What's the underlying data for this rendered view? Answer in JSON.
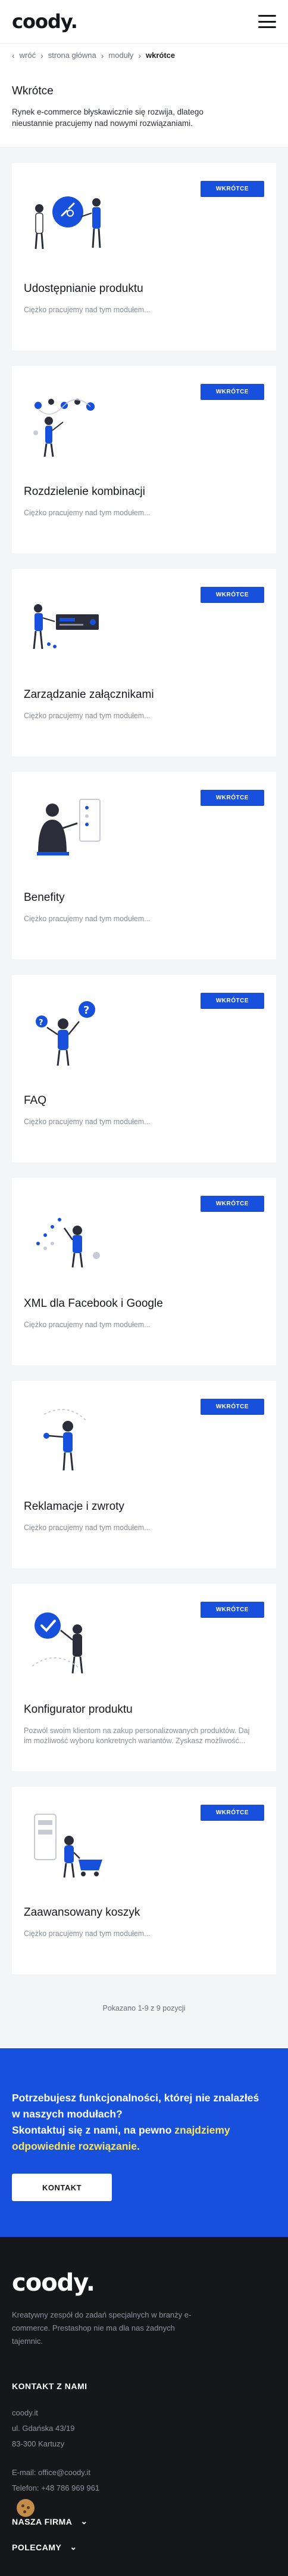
{
  "header": {
    "logo": "coody.",
    "menu_icon": "hamburger-icon"
  },
  "breadcrumb": {
    "back_label": "wróć",
    "items": [
      "strona główna",
      "moduły",
      "wkrótce"
    ]
  },
  "intro": {
    "title": "Wkrótce",
    "text": "Rynek e-commerce błyskawicznie się rozwija, dlatego nieustannie pracujemy nad nowymi rozwiązaniami."
  },
  "badge_label": "WKRÓTCE",
  "cards": [
    {
      "title": "Udostępnianie produktu",
      "desc": "Ciężko pracujemy nad tym modułem...",
      "illustration": "share-illustration"
    },
    {
      "title": "Rozdzielenie kombinacji",
      "desc": "Ciężko pracujemy nad tym modułem...",
      "illustration": "combinations-illustration"
    },
    {
      "title": "Zarządzanie załącznikami",
      "desc": "Ciężko pracujemy nad tym modułem...",
      "illustration": "attachments-illustration"
    },
    {
      "title": "Benefity",
      "desc": "Ciężko pracujemy nad tym modułem...",
      "illustration": "benefits-illustration"
    },
    {
      "title": "FAQ",
      "desc": "Ciężko pracujemy nad tym modułem...",
      "illustration": "faq-illustration"
    },
    {
      "title": "XML dla Facebook i Google",
      "desc": "Ciężko pracujemy nad tym modułem...",
      "illustration": "xml-illustration"
    },
    {
      "title": "Reklamacje i zwroty",
      "desc": "Ciężko pracujemy nad tym modułem...",
      "illustration": "returns-illustration"
    },
    {
      "title": "Konfigurator produktu",
      "desc": "Pozwól swoim klientom na zakup personalizowanych produktów. Daj im możliwość wyboru konkretnych wariantów. Zyskasz możliwość...",
      "illustration": "configurator-illustration"
    },
    {
      "title": "Zaawansowany koszyk",
      "desc": "Ciężko pracujemy nad tym modułem...",
      "illustration": "cart-illustration"
    }
  ],
  "pager": "Pokazano 1-9 z 9 pozycji",
  "cta": {
    "text_a": "Potrzebujesz funkcjonalności, której nie znalazłeś w naszych modułach?",
    "text_b": "Skontaktuj się z nami, na pewno",
    "text_highlight": "znajdziemy odpowiednie rozwiązanie.",
    "button": "KONTAKT",
    "highlight_color": "#f8e55a"
  },
  "footer": {
    "logo": "coody.",
    "about": "Kreatywny zespół do zadań specjalnych w branży e-commerce. Prestashop nie ma dla nas żadnych tajemnic.",
    "contact_heading": "KONTAKT Z NAMI",
    "address": [
      "coody.it",
      "ul. Gdańska 43/19",
      "83-300 Kartuzy"
    ],
    "email": "E-mail: office@coody.it",
    "phone": "Telefon: +48 786 969 961",
    "accordions": [
      "NASZA FIRMA",
      "POLECAMY"
    ]
  },
  "colors": {
    "accent": "#1750dd",
    "footer_bg": "#16171b",
    "page_bg": "#f4f5f7"
  }
}
